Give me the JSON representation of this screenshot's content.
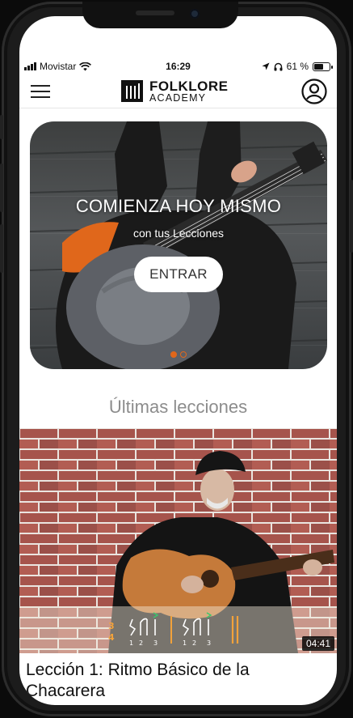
{
  "status_bar": {
    "carrier": "Movistar",
    "time": "16:29",
    "battery": "61 %",
    "battery_level": 0.61,
    "icons": [
      "signal-bars-icon",
      "wifi-icon",
      "location-arrow-icon",
      "headphones-icon",
      "battery-icon"
    ]
  },
  "header": {
    "menu_icon": "hamburger-menu-icon",
    "logo_line1": "FOLKLORE",
    "logo_line2": "ACADEMY",
    "profile_icon": "user-profile-icon"
  },
  "hero": {
    "title": "COMIENZA HOY MISMO",
    "subtitle": "con tus Lecciones",
    "button_label": "ENTRAR",
    "slides_total": 2,
    "active_slide": 1
  },
  "latest": {
    "section_title": "Últimas lecciones",
    "lessons": [
      {
        "title": "Lección 1: Ritmo Básico de la Chacarera",
        "duration": "04:41",
        "time_signature": "3\n4",
        "beat_numbers": [
          "1",
          "2",
          "3",
          "1",
          "2",
          "3"
        ]
      }
    ]
  },
  "colors": {
    "accent": "#e0671b",
    "text_primary": "#111111",
    "section_title": "#8c8c8c"
  }
}
